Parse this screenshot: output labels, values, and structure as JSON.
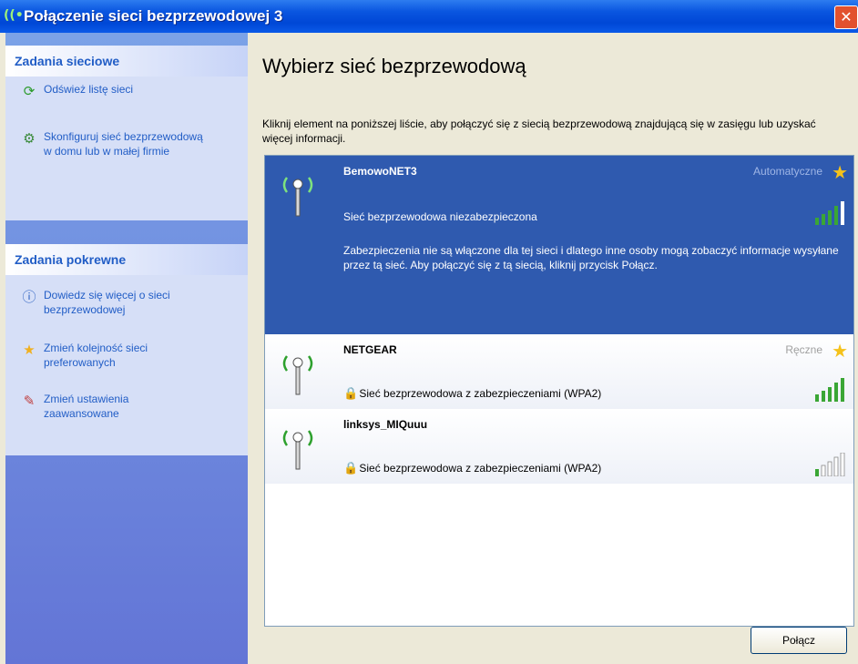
{
  "window": {
    "title": "Połączenie sieci bezprzewodowej 3",
    "close_label": "✕"
  },
  "sidebar": {
    "network_tasks": {
      "heading": "Zadania sieciowe",
      "items": [
        {
          "label": "Odśwież listę sieci",
          "icon": "refresh-icon"
        },
        {
          "label": "Skonfiguruj sieć bezprzewodową w domu lub w małej firmie",
          "icon": "setup-wizard-icon"
        }
      ]
    },
    "related_tasks": {
      "heading": "Zadania pokrewne",
      "items": [
        {
          "label": "Dowiedz się więcej o sieci bezprzewodowej",
          "icon": "info-icon"
        },
        {
          "label": "Zmień kolejność sieci preferowanych",
          "icon": "star-icon"
        },
        {
          "label": "Zmień ustawienia zaawansowane",
          "icon": "settings-icon"
        }
      ]
    }
  },
  "main": {
    "heading": "Wybierz sieć bezprzewodową",
    "instructions": "Kliknij element na poniższej liście, aby połączyć się z siecią bezprzewodową znajdującą się w zasięgu lub uzyskać więcej informacji.",
    "networks": [
      {
        "name": "BemowoNET3",
        "status": "Automatyczne",
        "security": "Sieć bezprzewodowa niezabezpieczona",
        "secured": false,
        "signal_bars": 4,
        "selected": true,
        "description": "Zabezpieczenia nie są włączone dla tej sieci i dlatego inne osoby mogą zobaczyć informacje wysyłane przez tą sieć. Aby połączyć się z tą siecią, kliknij przycisk Połącz."
      },
      {
        "name": "NETGEAR",
        "status": "Ręczne",
        "security": "Sieć bezprzewodowa z zabezpieczeniami (WPA2)",
        "secured": true,
        "signal_bars": 5,
        "selected": false
      },
      {
        "name": "linksys_MIQuuu",
        "status": "",
        "security": "Sieć bezprzewodowa z zabezpieczeniami (WPA2)",
        "secured": true,
        "signal_bars": 1,
        "selected": false
      }
    ],
    "connect_button": "Połącz"
  },
  "colors": {
    "title_bar": "#0a56e0",
    "selection": "#2f5aaf",
    "task_link": "#215dc6",
    "signal_on": "#3aa635",
    "star": "#f5c21b"
  }
}
